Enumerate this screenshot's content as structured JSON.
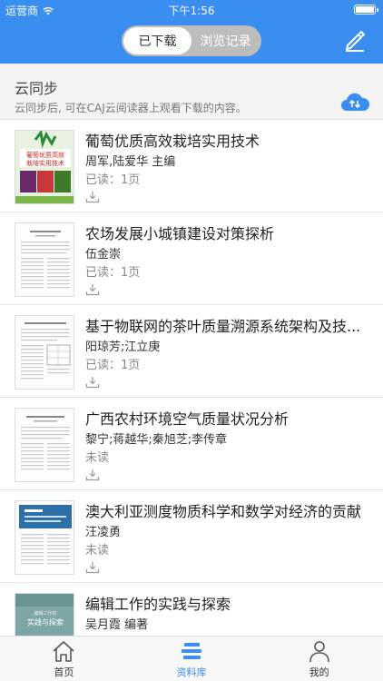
{
  "status_bar": {
    "carrier": "运营商",
    "time": "下午1:56"
  },
  "nav": {
    "tabs": [
      "已下载",
      "浏览记录"
    ],
    "active_tab": 0
  },
  "sync": {
    "title": "云同步",
    "desc": "云同步后, 可在CAJ云阅读器上观看下载的内容。"
  },
  "cover_texts": {
    "book1_line1": "葡萄优质高效",
    "book1_line2": "栽培实用技术",
    "book6_line1": "实践与探索",
    "book6_small": "编辑工作的"
  },
  "items": [
    {
      "title": "葡萄优质高效栽培实用技术",
      "author": "周军,陆爱华 主编",
      "status": "已读：1页"
    },
    {
      "title": "农场发展小城镇建设对策探析",
      "author": "伍金崇",
      "status": "已读：1页"
    },
    {
      "title": "基于物联网的茶叶质量溯源系统架构及技...",
      "author": "阳琼芳;江立庚",
      "status": "已读：1页"
    },
    {
      "title": "广西农村环境空气质量状况分析",
      "author": "黎宁;蒋越华;秦旭芝;李传章",
      "status": "未读"
    },
    {
      "title": "澳大利亚测度物质科学和数学对经济的贡献",
      "author": "汪凌勇",
      "status": "未读"
    },
    {
      "title": "编辑工作的实践与探索",
      "author": "吴月霞 编著",
      "status": ""
    }
  ],
  "tabbar": {
    "items": [
      "首页",
      "资料库",
      "我的"
    ],
    "active": 1
  },
  "colors": {
    "primary": "#3a8ef0",
    "segment_bg": "#bdbdbd",
    "banner_bg": "#f4f4f4"
  },
  "icons": {
    "edit": "pencil-icon",
    "cloud": "cloud-sync-icon",
    "download": "download-icon",
    "home": "home-icon",
    "library": "library-icon",
    "profile": "user-icon"
  }
}
